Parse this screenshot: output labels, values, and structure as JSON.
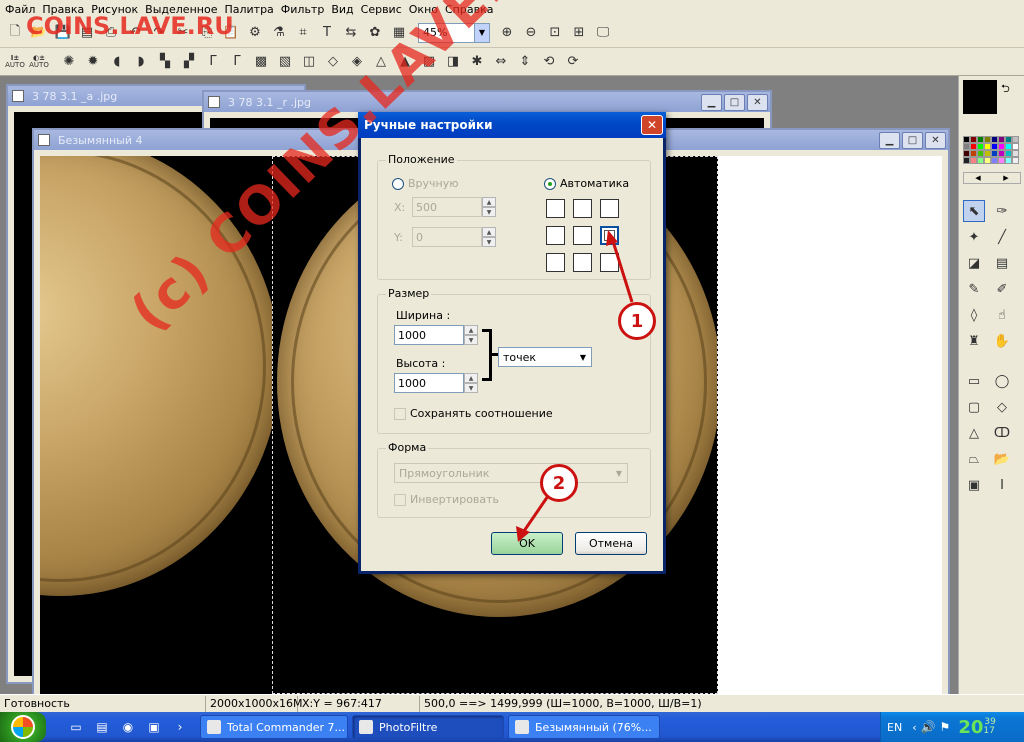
{
  "menu": [
    "Файл",
    "Правка",
    "Рисунок",
    "Выделенное",
    "Палитра",
    "Фильтр",
    "Вид",
    "Сервис",
    "Окно",
    "Справка"
  ],
  "toolbar": {
    "zoom": "45%",
    "auto_label_1": "AUTO",
    "auto_label_2": "AUTO"
  },
  "windows": {
    "back_left_title": "3 78 3.1 _a .jpg",
    "back_right_title": "3 78 3.1 _r .jpg",
    "front_title": "Безымянный 4"
  },
  "dialog": {
    "title": "Ручные настройки",
    "position": {
      "label": "Положение",
      "manual": "Вручную",
      "auto": "Автоматика",
      "x_label": "X:",
      "x_value": "500",
      "y_label": "Y:",
      "y_value": "0",
      "selected_anchor": "middle-right"
    },
    "size": {
      "label": "Размер",
      "width_label": "Ширина :",
      "width_value": "1000",
      "height_label": "Высота :",
      "height_value": "1000",
      "unit": "точек",
      "keep_ratio": "Сохранять соотношение"
    },
    "shape": {
      "label": "Форма",
      "shape_value": "Прямоугольник",
      "invert": "Инвертировать"
    },
    "ok": "OK",
    "cancel": "Отмена"
  },
  "statusbar": {
    "status": "Готовность",
    "image_size": "2000x1000x16M",
    "xy": "X:Y = 967:417",
    "selection": "500,0 ==> 1499,999 (Ш=1000, В=1000, Ш/В=1)"
  },
  "taskbar": {
    "tasks": [
      "Total Commander 7...",
      "PhotoFiltre",
      "Безымянный (76%..."
    ],
    "lang": "EN",
    "clock": "20",
    "clock_min": "39",
    "clock_sec": "17"
  },
  "annotations": {
    "watermark": "(c) COINS.LAVE.RU",
    "watermark_top": "COINS.LAVE.RU",
    "callout_1": "1",
    "callout_2": "2",
    "accent": "#cc1111"
  }
}
